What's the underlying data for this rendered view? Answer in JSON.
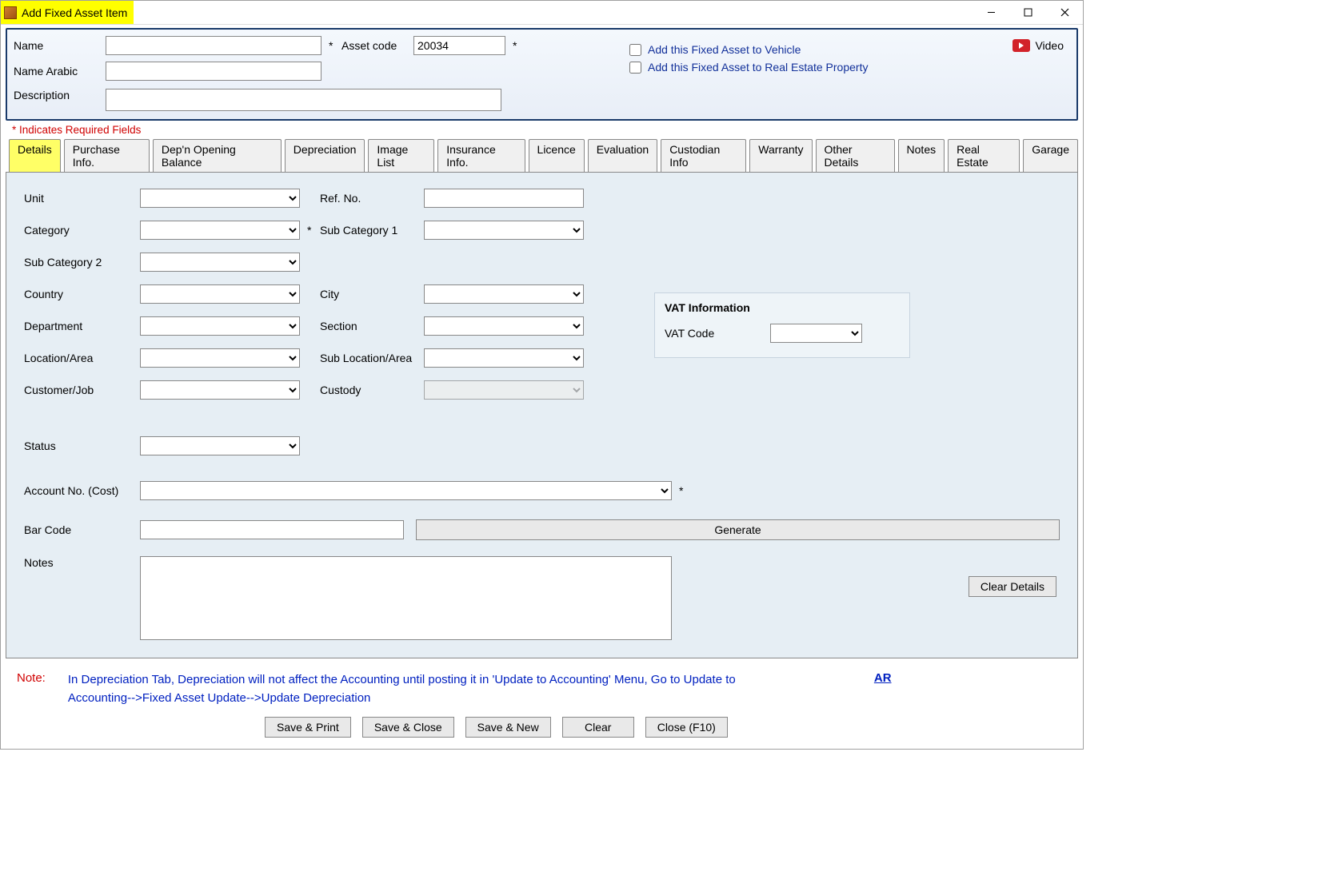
{
  "window": {
    "title": "Add Fixed Asset Item"
  },
  "header": {
    "name_label": "Name",
    "name_value": "",
    "name_arabic_label": "Name Arabic",
    "name_arabic_value": "",
    "asset_code_label": "Asset code",
    "asset_code_value": "20034",
    "description_label": "Description",
    "description_value": "",
    "chk_vehicle_label": "Add this Fixed Asset to Vehicle",
    "chk_realestate_label": "Add this Fixed Asset to Real Estate Property",
    "video_label": "Video",
    "required_note": "* Indicates Required Fields"
  },
  "tabs": [
    "Details",
    "Purchase Info.",
    "Dep'n Opening Balance",
    "Depreciation",
    "Image List",
    "Insurance Info.",
    "Licence",
    "Evaluation",
    "Custodian Info",
    "Warranty",
    "Other Details",
    "Notes",
    "Real Estate",
    "Garage"
  ],
  "active_tab": "Details",
  "details": {
    "unit_label": "Unit",
    "refno_label": "Ref. No.",
    "category_label": "Category",
    "subcat1_label": "Sub Category 1",
    "subcat2_label": "Sub Category 2",
    "country_label": "Country",
    "city_label": "City",
    "department_label": "Department",
    "section_label": "Section",
    "location_label": "Location/Area",
    "sublocation_label": "Sub Location/Area",
    "customer_label": "Customer/Job",
    "custody_label": "Custody",
    "status_label": "Status",
    "account_label": "Account No. (Cost)",
    "barcode_label": "Bar Code",
    "generate_label": "Generate",
    "notes_label": "Notes",
    "clear_details_label": "Clear Details",
    "vat_title": "VAT Information",
    "vat_code_label": "VAT Code"
  },
  "footer": {
    "note_label": "Note:",
    "note_text": "In Depreciation Tab, Depreciation will not affect the Accounting until posting it in 'Update to Accounting' Menu, Go to Update to Accounting-->Fixed Asset Update-->Update Depreciation",
    "ar_link": "AR",
    "buttons": {
      "save_print": "Save & Print",
      "save_close": "Save & Close",
      "save_new": "Save & New",
      "clear": "Clear",
      "close": "Close (F10)"
    }
  }
}
